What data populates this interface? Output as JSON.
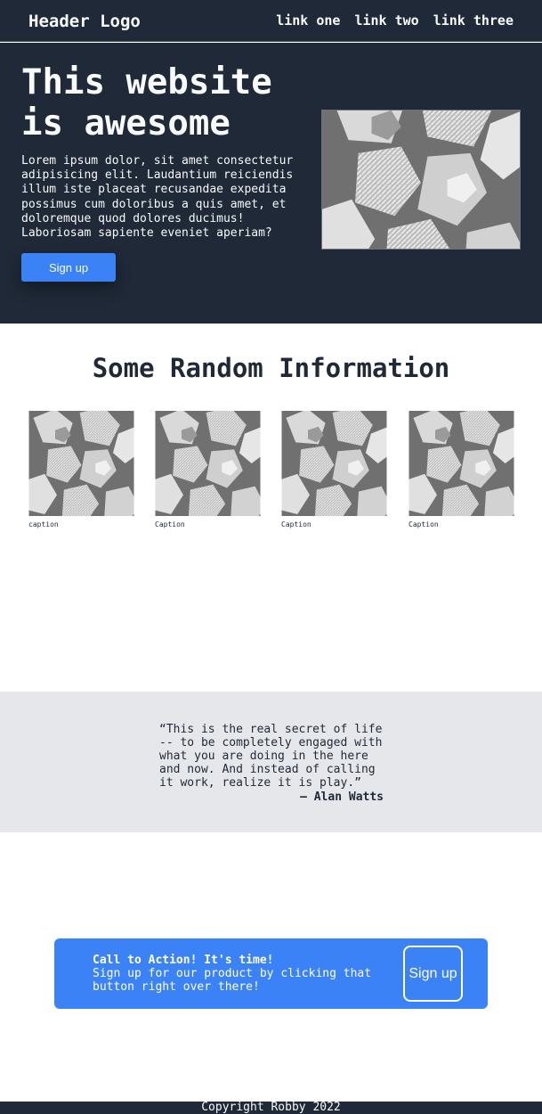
{
  "header": {
    "logo": "Header Logo",
    "links": [
      "link one",
      "link two",
      "link three"
    ]
  },
  "hero": {
    "title": "This website is awesome",
    "text": "Lorem ipsum dolor, sit amet consectetur adipisicing elit. Laudantium reiciendis illum iste placeat recusandae expedita possimus cum doloribus a quis amet, et doloremque quod dolores ducimus! Laboriosam sapiente eveniet aperiam?",
    "button_label": "Sign up"
  },
  "info": {
    "title": "Some Random Information",
    "captions": [
      "caption",
      "Caption",
      "Caption",
      "Caption"
    ]
  },
  "quote": {
    "text": "“This is the real secret of life -- to be completely engaged with what you are doing in the here and now. And instead of calling it work, realize it is play.”",
    "author": "— Alan Watts"
  },
  "cta": {
    "title": "Call to Action! It's time!",
    "text": "Sign up for our product by clicking that button right over there!",
    "button_label": "Sign up"
  },
  "footer": {
    "text": "Copyright Robby 2022"
  },
  "colors": {
    "dark": "#1f2937",
    "accent": "#3b82f6",
    "light_gray": "#e5e7eb"
  }
}
